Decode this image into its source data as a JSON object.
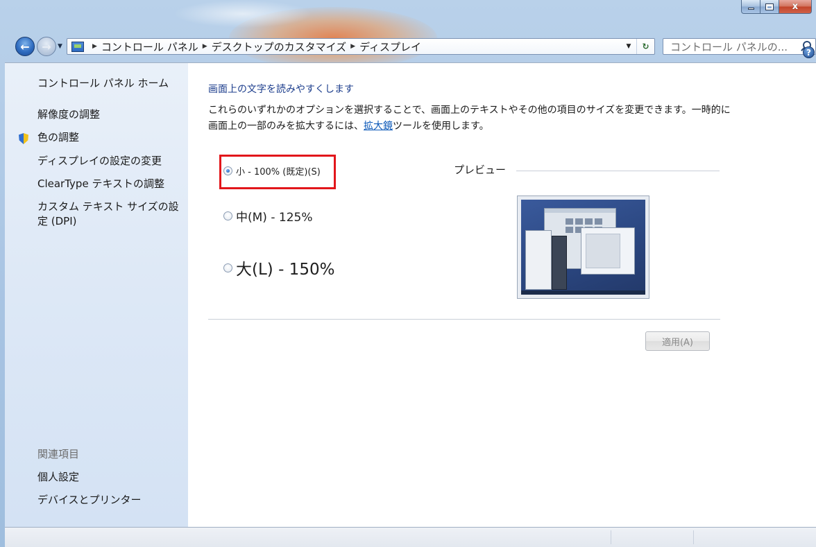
{
  "window": {
    "caption_buttons": {
      "minimize_icon": "minimize-icon",
      "maximize_icon": "maximize-icon",
      "close_glyph": "x"
    }
  },
  "navigation": {
    "back_icon": "back-arrow-icon",
    "forward_icon": "forward-arrow-icon",
    "address_icon": "control-panel-icon",
    "breadcrumbs": [
      "コントロール パネル",
      "デスクトップのカスタマイズ",
      "ディスプレイ"
    ],
    "search_placeholder": "コントロール パネルの..."
  },
  "sidebar": {
    "home": "コントロール パネル ホーム",
    "links": [
      "解像度の調整",
      "色の調整",
      "ディスプレイの設定の変更",
      "ClearType テキストの調整"
    ],
    "custom_dpi_line1": "カスタム テキスト サイズの設",
    "custom_dpi_line2": "定 (DPI)",
    "related_header": "関連項目",
    "related_links": [
      "個人設定",
      "デバイスとプリンター"
    ]
  },
  "main": {
    "heading": "画面上の文字を読みやすくします",
    "description_part1": "これらのいずれかのオプションを選択することで、画面上のテキストやその他の項目のサイズを変更できます。一時的に画面上の一部のみを拡大するには、",
    "description_link": "拡大鏡",
    "description_part2": "ツールを使用します。",
    "options": [
      {
        "label": "小 - 100% (既定)(S)",
        "checked": true
      },
      {
        "label": "中(M) - 125%",
        "checked": false
      },
      {
        "label": "大(L) - 150%",
        "checked": false
      }
    ],
    "preview_label": "プレビュー",
    "apply_button": "適用(A)"
  },
  "colors": {
    "heading_link": "#1c3d8c",
    "link": "#0b58b8",
    "highlight_box": "#e2161b"
  }
}
